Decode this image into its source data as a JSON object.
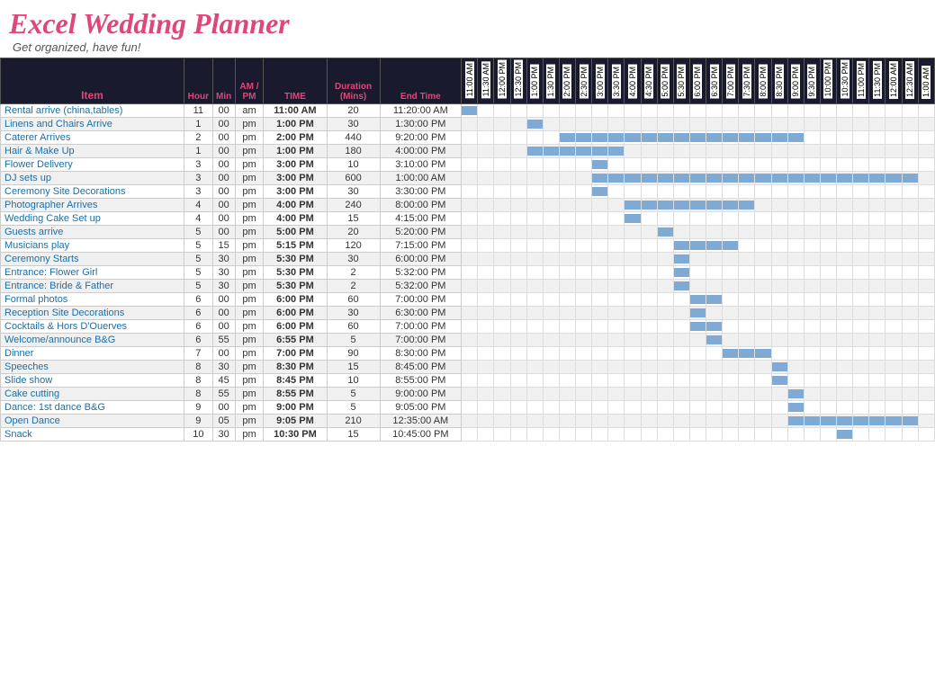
{
  "header": {
    "title": "Excel Wedding Planner",
    "subtitle": "Get organized, have fun!"
  },
  "columns": {
    "item": "Item",
    "hour": "Hour",
    "min": "Min",
    "ampm": "AM / PM",
    "time": "TIME",
    "duration": "Duration (Mins)",
    "endtime": "End Time"
  },
  "gantt_slots": [
    "11:00 AM",
    "11:30 AM",
    "12:00 PM",
    "12:30 PM",
    "1:00 PM",
    "1:30 PM",
    "2:00 PM",
    "2:30 PM",
    "3:00 PM",
    "3:30 PM",
    "4:00 PM",
    "4:30 PM",
    "5:00 PM",
    "5:30 PM",
    "6:00 PM",
    "6:30 PM",
    "7:00 PM",
    "7:30 PM",
    "8:00 PM",
    "8:30 PM",
    "9:00 PM",
    "9:30 PM",
    "10:00 PM",
    "10:30 PM",
    "11:00 PM",
    "11:30 PM",
    "12:00 AM",
    "12:30 AM",
    "1:00 AM"
  ],
  "rows": [
    {
      "item": "Rental arrive (china,tables)",
      "hour": 11,
      "min": "00",
      "ampm": "am",
      "time": "11:00 AM",
      "duration": 20,
      "endtime": "11:20:00 AM",
      "gantt_start": 0,
      "gantt_span": 1
    },
    {
      "item": "Linens and Chairs Arrive",
      "hour": 1,
      "min": "00",
      "ampm": "pm",
      "time": "1:00 PM",
      "duration": 30,
      "endtime": "1:30:00 PM",
      "gantt_start": 4,
      "gantt_span": 1
    },
    {
      "item": "Caterer Arrives",
      "hour": 2,
      "min": "00",
      "ampm": "pm",
      "time": "2:00 PM",
      "duration": 440,
      "endtime": "9:20:00 PM",
      "gantt_start": 6,
      "gantt_span": 15
    },
    {
      "item": "Hair & Make Up",
      "hour": 1,
      "min": "00",
      "ampm": "pm",
      "time": "1:00 PM",
      "duration": 180,
      "endtime": "4:00:00 PM",
      "gantt_start": 4,
      "gantt_span": 6
    },
    {
      "item": "Flower Delivery",
      "hour": 3,
      "min": "00",
      "ampm": "pm",
      "time": "3:00 PM",
      "duration": 10,
      "endtime": "3:10:00 PM",
      "gantt_start": 8,
      "gantt_span": 1
    },
    {
      "item": "DJ sets up",
      "hour": 3,
      "min": "00",
      "ampm": "pm",
      "time": "3:00 PM",
      "duration": 600,
      "endtime": "1:00:00 AM",
      "gantt_start": 8,
      "gantt_span": 20
    },
    {
      "item": "Ceremony Site Decorations",
      "hour": 3,
      "min": "00",
      "ampm": "pm",
      "time": "3:00 PM",
      "duration": 30,
      "endtime": "3:30:00 PM",
      "gantt_start": 8,
      "gantt_span": 1
    },
    {
      "item": "Photographer Arrives",
      "hour": 4,
      "min": "00",
      "ampm": "pm",
      "time": "4:00 PM",
      "duration": 240,
      "endtime": "8:00:00 PM",
      "gantt_start": 10,
      "gantt_span": 8
    },
    {
      "item": "Wedding Cake Set up",
      "hour": 4,
      "min": "00",
      "ampm": "pm",
      "time": "4:00 PM",
      "duration": 15,
      "endtime": "4:15:00 PM",
      "gantt_start": 10,
      "gantt_span": 1
    },
    {
      "item": "Guests arrive",
      "hour": 5,
      "min": "00",
      "ampm": "pm",
      "time": "5:00 PM",
      "duration": 20,
      "endtime": "5:20:00 PM",
      "gantt_start": 12,
      "gantt_span": 1
    },
    {
      "item": "Musicians play",
      "hour": 5,
      "min": "15",
      "ampm": "pm",
      "time": "5:15 PM",
      "duration": 120,
      "endtime": "7:15:00 PM",
      "gantt_start": 13,
      "gantt_span": 4
    },
    {
      "item": "Ceremony Starts",
      "hour": 5,
      "min": "30",
      "ampm": "pm",
      "time": "5:30 PM",
      "duration": 30,
      "endtime": "6:00:00 PM",
      "gantt_start": 13,
      "gantt_span": 1
    },
    {
      "item": "Entrance: Flower Girl",
      "hour": 5,
      "min": "30",
      "ampm": "pm",
      "time": "5:30 PM",
      "duration": 2,
      "endtime": "5:32:00 PM",
      "gantt_start": 13,
      "gantt_span": 1
    },
    {
      "item": "Entrance: Bride & Father",
      "hour": 5,
      "min": "30",
      "ampm": "pm",
      "time": "5:30 PM",
      "duration": 2,
      "endtime": "5:32:00 PM",
      "gantt_start": 13,
      "gantt_span": 1
    },
    {
      "item": "Formal photos",
      "hour": 6,
      "min": "00",
      "ampm": "pm",
      "time": "6:00 PM",
      "duration": 60,
      "endtime": "7:00:00 PM",
      "gantt_start": 14,
      "gantt_span": 2
    },
    {
      "item": "Reception Site Decorations",
      "hour": 6,
      "min": "00",
      "ampm": "pm",
      "time": "6:00 PM",
      "duration": 30,
      "endtime": "6:30:00 PM",
      "gantt_start": 14,
      "gantt_span": 1
    },
    {
      "item": "Cocktails & Hors D'Ouerves",
      "hour": 6,
      "min": "00",
      "ampm": "pm",
      "time": "6:00 PM",
      "duration": 60,
      "endtime": "7:00:00 PM",
      "gantt_start": 14,
      "gantt_span": 2
    },
    {
      "item": "Welcome/announce B&G",
      "hour": 6,
      "min": "55",
      "ampm": "pm",
      "time": "6:55 PM",
      "duration": 5,
      "endtime": "7:00:00 PM",
      "gantt_start": 15,
      "gantt_span": 1
    },
    {
      "item": "Dinner",
      "hour": 7,
      "min": "00",
      "ampm": "pm",
      "time": "7:00 PM",
      "duration": 90,
      "endtime": "8:30:00 PM",
      "gantt_start": 16,
      "gantt_span": 3
    },
    {
      "item": "Speeches",
      "hour": 8,
      "min": "30",
      "ampm": "pm",
      "time": "8:30 PM",
      "duration": 15,
      "endtime": "8:45:00 PM",
      "gantt_start": 19,
      "gantt_span": 1
    },
    {
      "item": "Slide show",
      "hour": 8,
      "min": "45",
      "ampm": "pm",
      "time": "8:45 PM",
      "duration": 10,
      "endtime": "8:55:00 PM",
      "gantt_start": 19,
      "gantt_span": 1
    },
    {
      "item": "Cake cutting",
      "hour": 8,
      "min": "55",
      "ampm": "pm",
      "time": "8:55 PM",
      "duration": 5,
      "endtime": "9:00:00 PM",
      "gantt_start": 20,
      "gantt_span": 1
    },
    {
      "item": "Dance: 1st dance B&G",
      "hour": 9,
      "min": "00",
      "ampm": "pm",
      "time": "9:00 PM",
      "duration": 5,
      "endtime": "9:05:00 PM",
      "gantt_start": 20,
      "gantt_span": 1
    },
    {
      "item": "Open Dance",
      "hour": 9,
      "min": "05",
      "ampm": "pm",
      "time": "9:05 PM",
      "duration": 210,
      "endtime": "12:35:00 AM",
      "gantt_start": 20,
      "gantt_span": 8
    },
    {
      "item": "Snack",
      "hour": 10,
      "min": "30",
      "ampm": "pm",
      "time": "10:30 PM",
      "duration": 15,
      "endtime": "10:45:00 PM",
      "gantt_start": 23,
      "gantt_span": 1
    }
  ]
}
